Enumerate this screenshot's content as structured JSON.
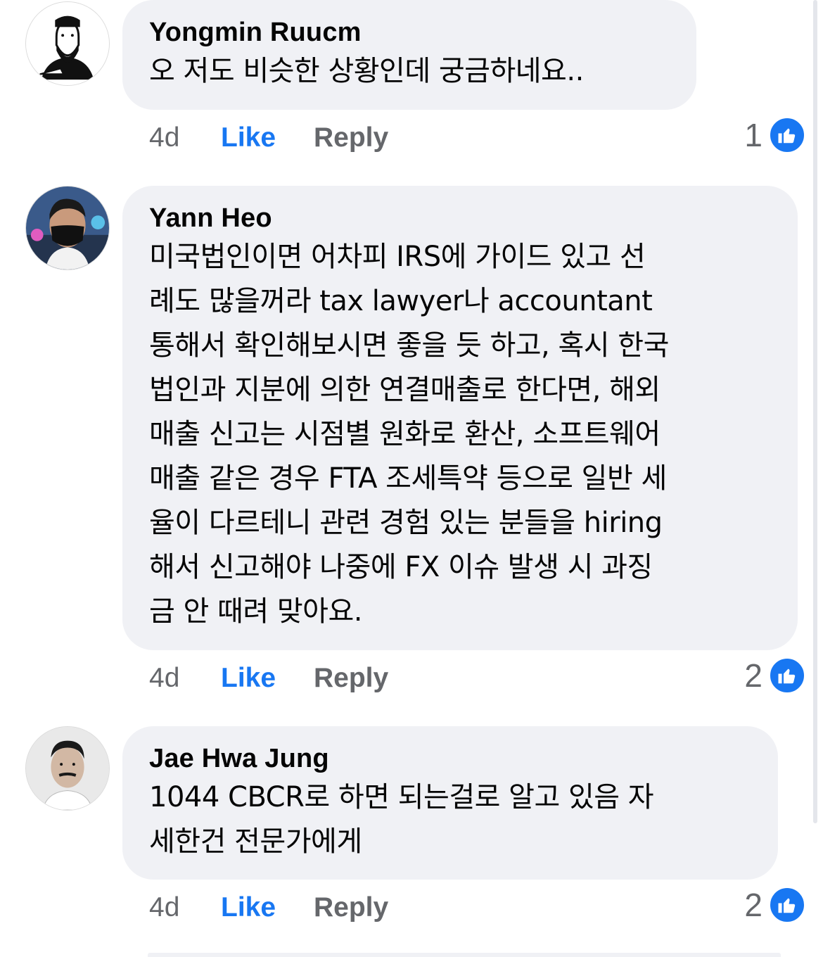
{
  "comments": [
    {
      "author": "Yongmin Ruucm",
      "text": "오 저도 비슷한 상황인데 궁금하네요..",
      "time": "4d",
      "like_label": "Like",
      "reply_label": "Reply",
      "reaction_count": "1"
    },
    {
      "author": "Yann Heo",
      "text": "미국법인이면 어차피 IRS에 가이드 있고 선\n례도 많을꺼라 tax lawyer나 accountant\n통해서 확인해보시면 좋을 듯 하고, 혹시 한국\n법인과 지분에 의한 연결매출로 한다면, 해외\n매출 신고는 시점별 원화로 환산, 소프트웨어\n매출 같은 경우 FTA 조세특약 등으로 일반 세\n율이 다르테니 관련 경험 있는 분들을 hiring\n해서 신고해야 나중에 FX 이슈 발생 시 과징\n금 안 때려 맞아요.",
      "time": "4d",
      "like_label": "Like",
      "reply_label": "Reply",
      "reaction_count": "2"
    },
    {
      "author": "Jae Hwa Jung",
      "text": "1044 CBCR로 하면 되는걸로 알고 있음 자\n세한건 전문가에게",
      "time": "4d",
      "like_label": "Like",
      "reply_label": "Reply",
      "reaction_count": "2"
    }
  ],
  "colors": {
    "bubble": "#f0f1f5",
    "like_blue": "#1877f2",
    "secondary_text": "#65676b"
  },
  "icons": {
    "reaction": "thumbs-up-icon"
  }
}
